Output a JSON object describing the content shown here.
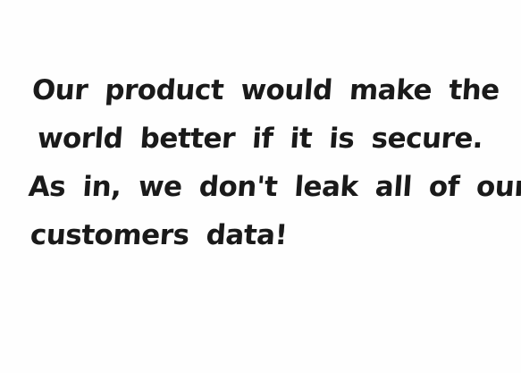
{
  "note": {
    "lines": [
      "Our product would make the",
      "world better if it is secure.",
      "As in, we don't leak all of our",
      "customers data!"
    ]
  },
  "colors": {
    "paper": "#fefefe",
    "ink": "#1a1a1a"
  }
}
